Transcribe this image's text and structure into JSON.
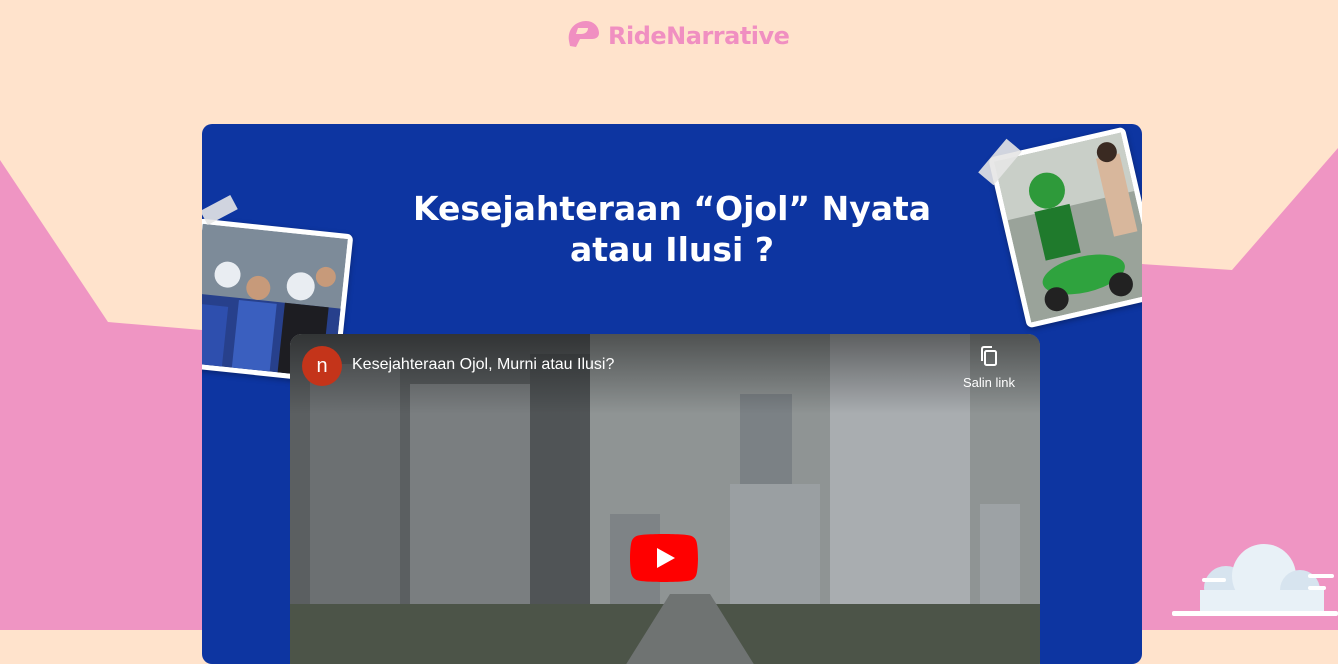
{
  "brand": {
    "name": "RideNarrative",
    "color": "#f08fc1"
  },
  "article": {
    "title_line1": "Kesejahteraan “Ojol” Nyata",
    "title_line2": "atau Ilusi ?"
  },
  "video": {
    "channel_initial": "n",
    "title": "Kesejahteraan Ojol, Murni atau Ilusi?",
    "copy_link_label": "Salin link"
  },
  "colors": {
    "page_background": "#ffe3cc",
    "pink_accent": "#ef95c3",
    "card_background": "#0d35a1",
    "youtube_red": "#ff0000"
  },
  "icons": [
    "helmet-logo-icon",
    "copy-icon",
    "youtube-play-icon",
    "cloud-icon"
  ]
}
